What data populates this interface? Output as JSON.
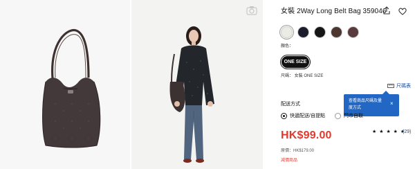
{
  "gallery": {
    "images": [
      {
        "alt": "",
        "icon": "bag-image"
      },
      {
        "alt": "",
        "icon": "model-image"
      }
    ]
  },
  "product": {
    "title": "女裝 2Way Long Belt Bag 359046",
    "colors": [
      "#ecece4",
      "#1b1d2b",
      "#161616",
      "#4b3730",
      "#5a3a3a"
    ],
    "color_label": "顏色：",
    "size_option": "ONE SIZE",
    "size_label": "尺碼： 女裝 ONE SIZE",
    "size_chart_link": "尺碼表",
    "tooltip": {
      "text": "查看商品尺碼及量度方式",
      "close": "×"
    },
    "delivery_heading": "配送方式",
    "delivery_options": [
      {
        "label": "快遞配送/自提點",
        "selected": true
      },
      {
        "label": "門市自取",
        "selected": false
      }
    ],
    "price": "HK$99.00",
    "stars": "★ ★ ★ ★ ★",
    "rating_count": "(29)",
    "original_price": "原價：HK$179.00",
    "sale_tag": "減價商品"
  },
  "colors": {
    "price": "#e03a2f",
    "link": "#1b4ea3",
    "tooltip_bg": "#2267c4"
  }
}
